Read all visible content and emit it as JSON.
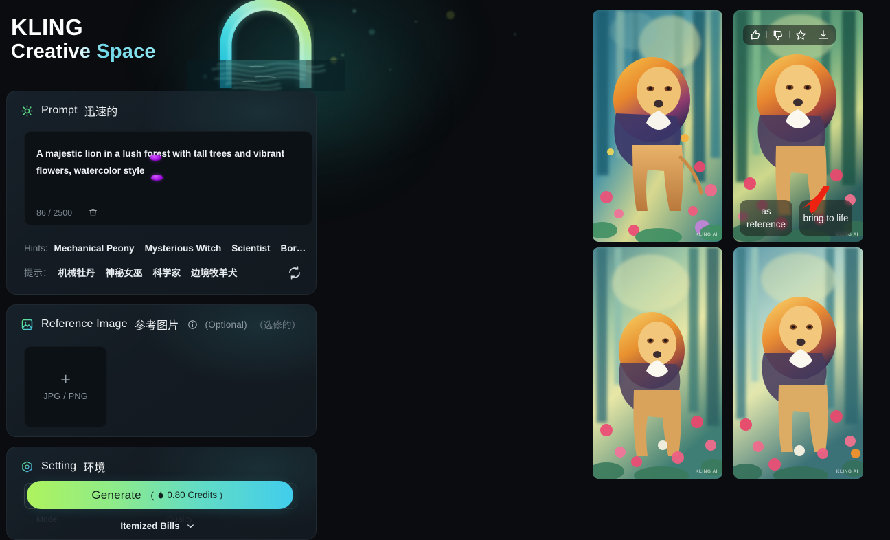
{
  "brand": {
    "line1": "KLING",
    "line2": "Creative Space",
    "accent": "#6fd8e8"
  },
  "prompt_card": {
    "icon": "sun-icon",
    "title": "Prompt",
    "title_cn": "迅速的",
    "textarea_value": "A majestic lion in a lush forest with tall trees and vibrant flowers, watercolor style",
    "char_count": "86 / 2500",
    "delete_icon": "trash-icon",
    "hints_label": "Hints:",
    "hints": [
      "Mechanical Peony",
      "Mysterious Witch",
      "Scientist",
      "Bor…"
    ],
    "hints_label_cn": "提示：",
    "hints_cn": [
      "机械牡丹",
      "神秘女巫",
      "科学家",
      "边境牧羊犬"
    ],
    "refresh_icon": "refresh-icon"
  },
  "reference_card": {
    "icon": "image-icon",
    "title": "Reference Image",
    "title_cn": "参考图片",
    "info_icon": "info-icon",
    "optional": "(Optional)",
    "optional_cn": "（选修的）",
    "upload_plus": "+",
    "upload_formats": "JPG / PNG"
  },
  "setting_card": {
    "icon": "hexagon-icon",
    "title": "Setting",
    "title_cn": "环境"
  },
  "generate": {
    "label": "Generate",
    "flame_icon": "flame-icon",
    "cost": "（",
    "credits": "0.80 Credits",
    "cost_close": "）",
    "bills_label": "Itemized Bills",
    "chevron_icon": "chevron-down-icon"
  },
  "results": {
    "toolbar": [
      {
        "icon": "thumbs-up-icon",
        "name": "like-button"
      },
      {
        "icon": "thumbs-down-icon",
        "name": "dislike-button"
      },
      {
        "icon": "star-icon",
        "name": "favorite-button"
      },
      {
        "icon": "download-icon",
        "name": "download-button"
      }
    ],
    "actions": [
      {
        "label": "as reference",
        "name": "as-reference-button"
      },
      {
        "label": "bring to life",
        "name": "bring-to-life-button"
      }
    ],
    "watermark": "KLING AI",
    "images": [
      {
        "alt": "watercolor lion standing in sunlit forest with pink flowers"
      },
      {
        "alt": "watercolor lion portrait in green forest with red flowers"
      },
      {
        "alt": "watercolor lion walking through bright forest clearing"
      },
      {
        "alt": "watercolor lion among tall trees and pink blossoms"
      }
    ],
    "annotation": {
      "icon": "red-arrow-cursor",
      "color": "#ee2211"
    }
  }
}
